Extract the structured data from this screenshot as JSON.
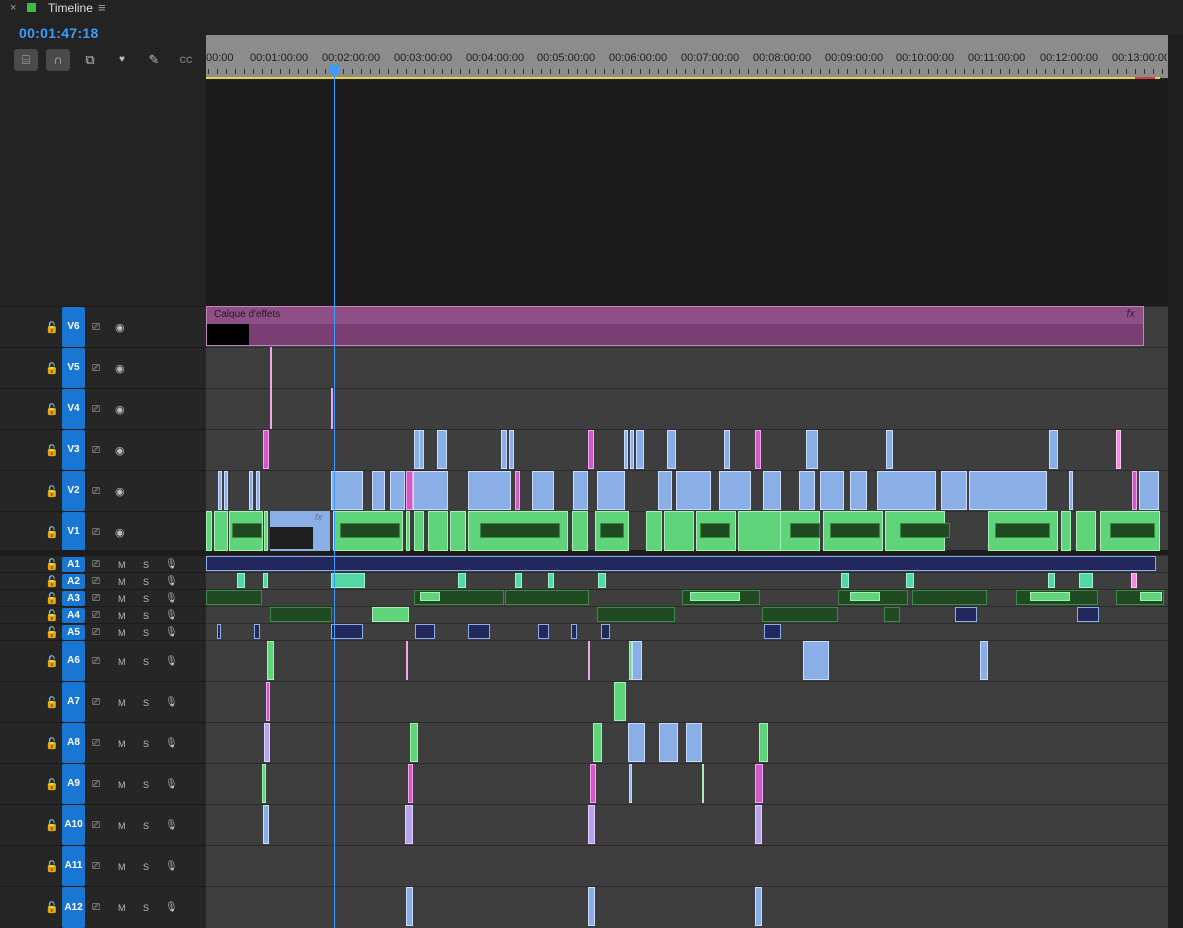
{
  "panel": {
    "close": "×",
    "title": "Timeline",
    "menu": "≡"
  },
  "timecode": "00:01:47:18",
  "tools": [
    {
      "name": "insert-sequence-icon",
      "glyph": "⌸"
    },
    {
      "name": "snap-icon",
      "glyph": "∩"
    },
    {
      "name": "linked-selection-icon",
      "glyph": "⧉"
    },
    {
      "name": "add-marker-icon",
      "glyph": "♥"
    },
    {
      "name": "wrench-icon",
      "glyph": "✎"
    },
    {
      "name": "captions-icon",
      "glyph": "CC"
    }
  ],
  "ruler": {
    "labels": [
      "00:00",
      "00:01:00:00",
      "00:02:00:00",
      "00:03:00:00",
      "00:04:00:00",
      "00:05:00:00",
      "00:06:00:00",
      "00:07:00:00",
      "00:08:00:00",
      "00:09:00:00",
      "00:10:00:00",
      "00:11:00:00",
      "00:12:00:00",
      "00:13:00:00"
    ]
  },
  "effects_clip": {
    "label": "Calque d'effets",
    "badge": "fx"
  },
  "v1_badge": "fx",
  "video_tracks": [
    "V6",
    "V5",
    "V4",
    "V3",
    "V2",
    "V1"
  ],
  "audio_tracks": [
    "A1",
    "A2",
    "A3",
    "A4",
    "A5",
    "A6",
    "A7",
    "A8",
    "A9",
    "A10",
    "A11",
    "A12"
  ],
  "track_controls": {
    "lock": "🔓",
    "film": "⎚",
    "eye": "◉",
    "mute": "M",
    "solo": "S",
    "mic": "🎙"
  }
}
